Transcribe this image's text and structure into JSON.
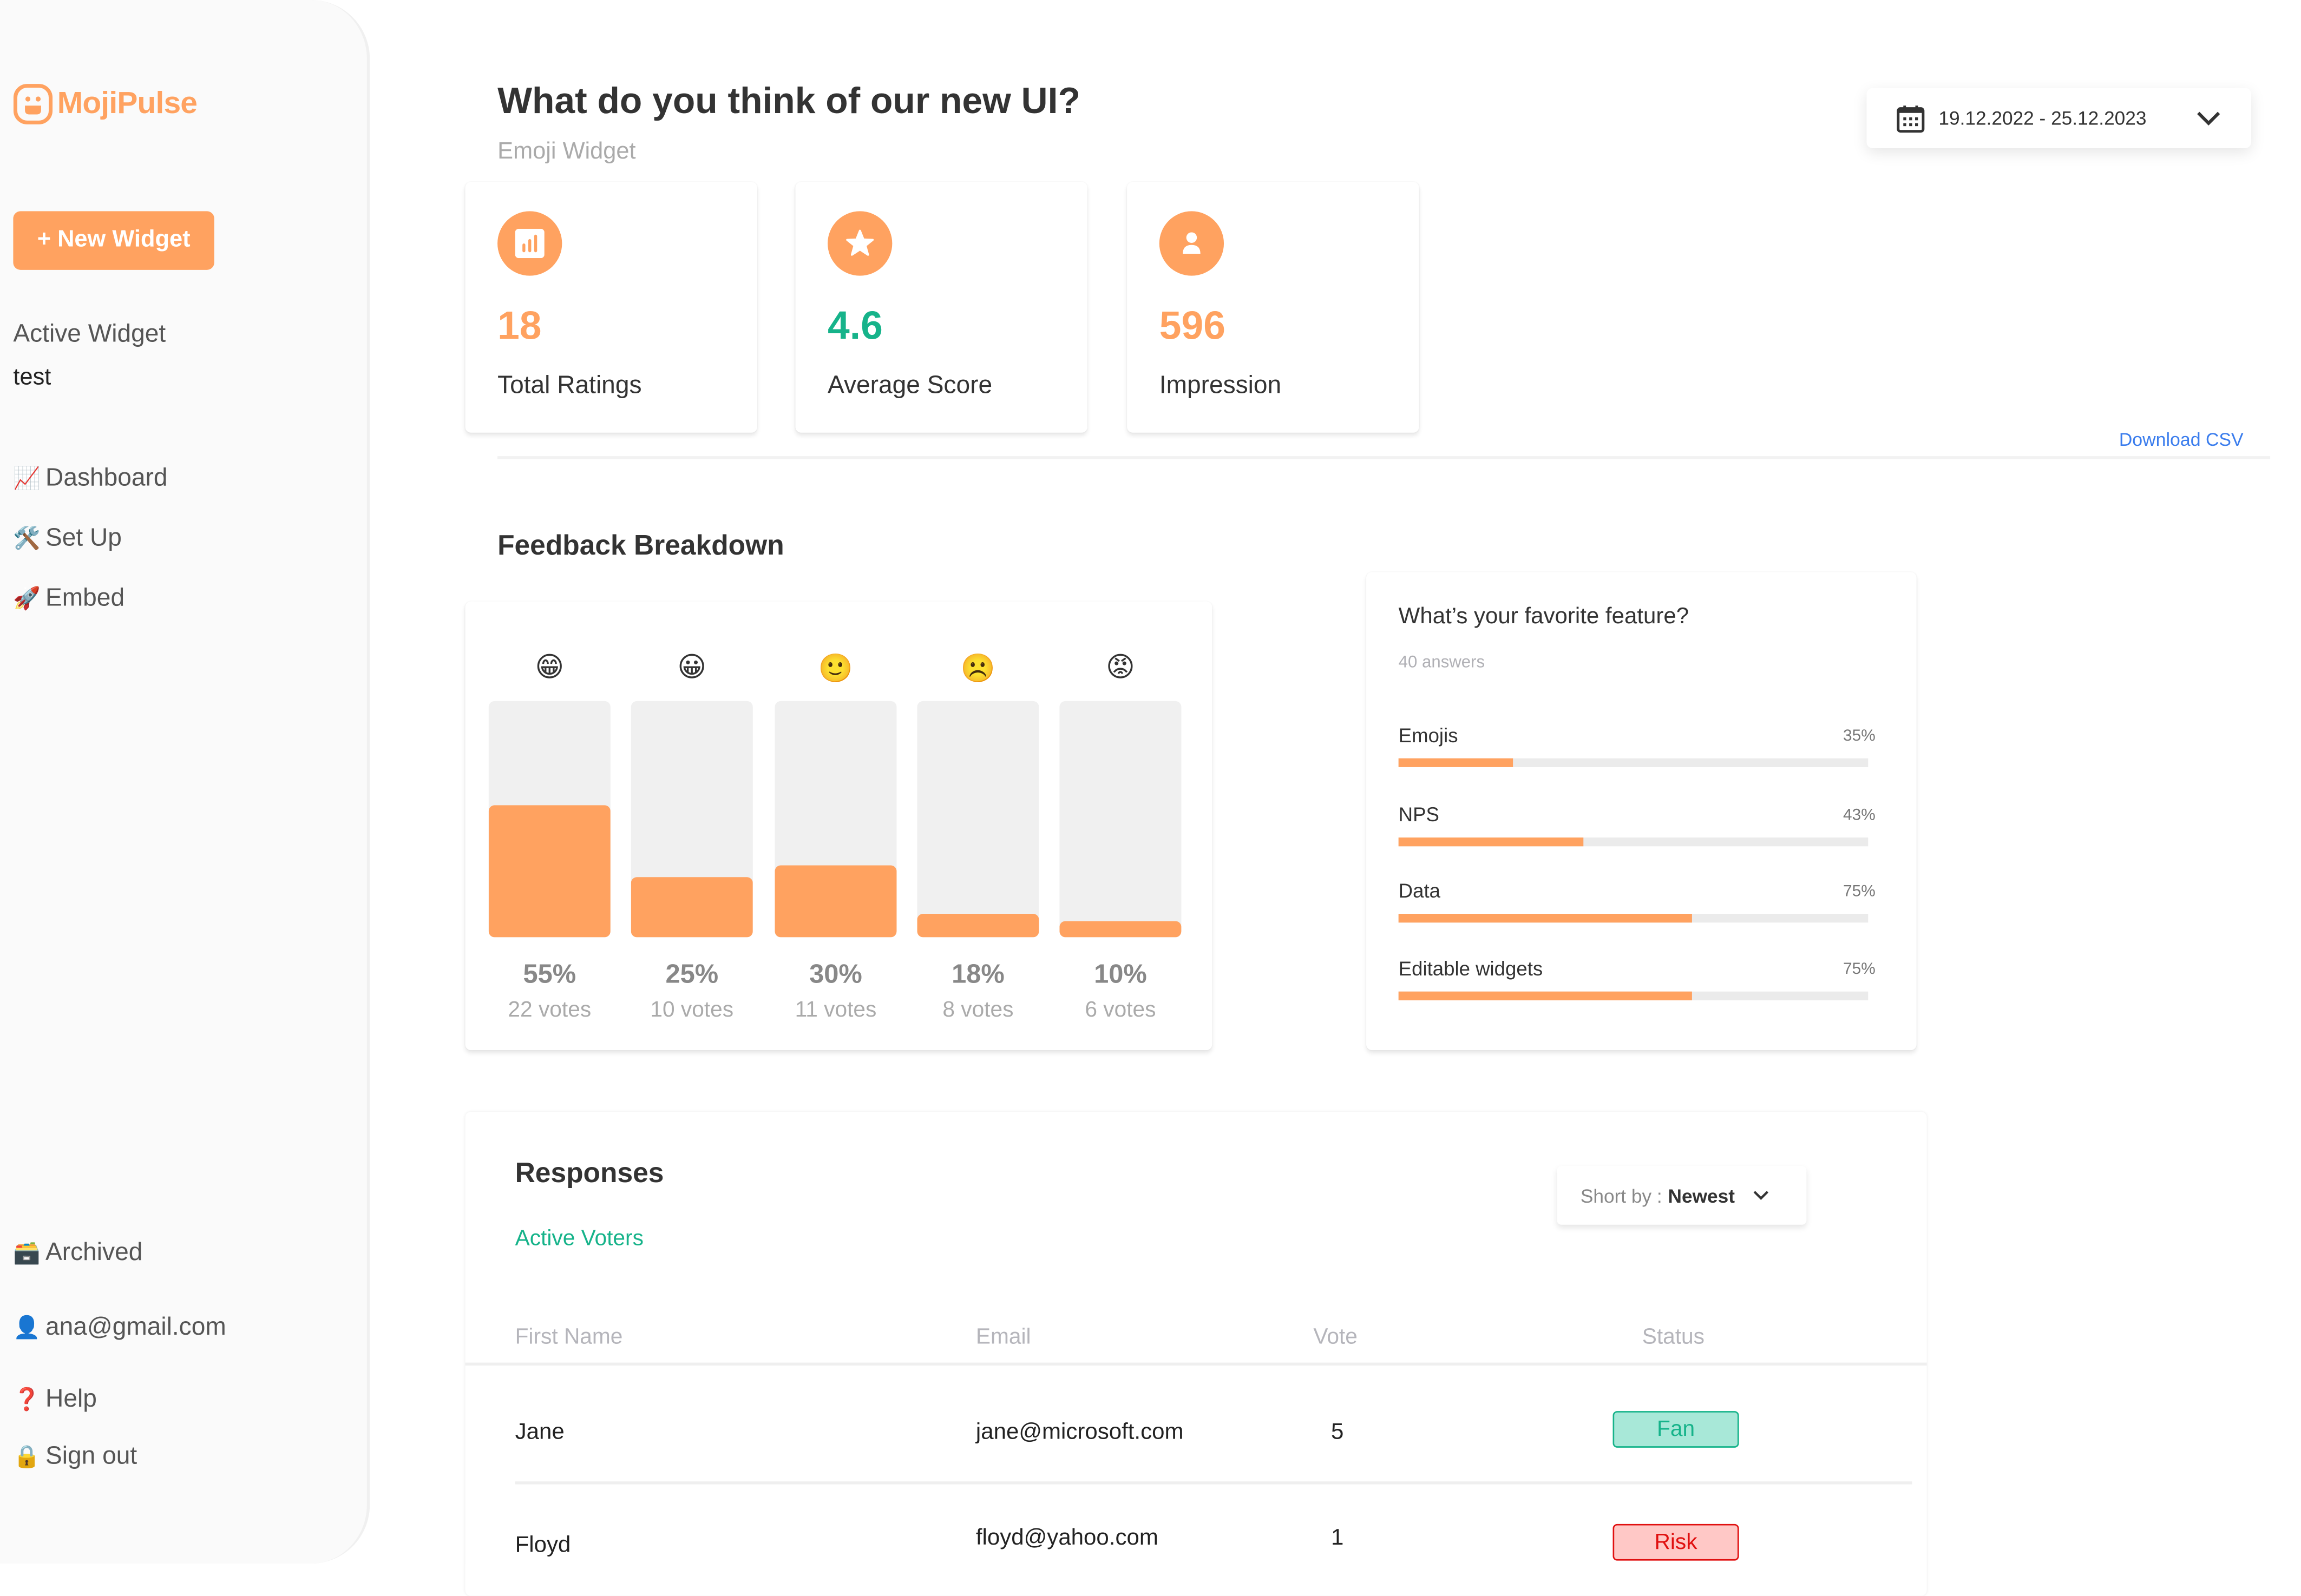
{
  "app": {
    "name": "MojiPulse",
    "brand_color": "#FFA260",
    "positive_color": "#16B38A",
    "link_color": "#3B7DED"
  },
  "sidebar": {
    "new_widget_label": "+ New Widget",
    "active_widget_label": "Active Widget",
    "active_widget_value": "test",
    "nav": [
      {
        "icon": "📈",
        "icon_name": "chart-increasing-icon",
        "label": "Dashboard"
      },
      {
        "icon": "🛠️",
        "icon_name": "hammer-wrench-icon",
        "label": "Set Up"
      },
      {
        "icon": "🚀",
        "icon_name": "rocket-icon",
        "label": "Embed"
      }
    ],
    "bottom": [
      {
        "icon": "🗃️",
        "icon_name": "card-file-box-icon",
        "label": "Archived"
      },
      {
        "icon": "👤",
        "icon_name": "user-icon",
        "label": "ana@gmail.com"
      },
      {
        "icon": "❓",
        "icon_name": "question-mark-icon",
        "label": "Help"
      },
      {
        "icon": "🔒",
        "icon_name": "lock-icon",
        "label": "Sign out"
      }
    ]
  },
  "header": {
    "title": "What do you think of our new UI?",
    "subtitle": "Emoji Widget",
    "date_range": "19.12.2022 - 25.12.2023"
  },
  "stats": [
    {
      "icon_name": "bar-chart-icon",
      "value": "18",
      "label": "Total Ratings",
      "color": "#FFA260"
    },
    {
      "icon_name": "star-icon",
      "value": "4.6",
      "label": "Average Score",
      "color": "#16B38A"
    },
    {
      "icon_name": "user-icon",
      "value": "596",
      "label": "Impression",
      "color": "#FFA260"
    }
  ],
  "download_csv_label": "Download CSV",
  "feedback": {
    "title": "Feedback Breakdown",
    "items": [
      {
        "emoji": "😁",
        "icon_name": "beaming-face-icon",
        "percent": 55,
        "percent_label": "55%",
        "votes_label": "22 votes"
      },
      {
        "emoji": "😀",
        "icon_name": "grinning-face-icon",
        "percent": 25,
        "percent_label": "25%",
        "votes_label": "10 votes"
      },
      {
        "emoji": "🙂",
        "icon_name": "slightly-smiling-face-icon",
        "percent": 30,
        "percent_label": "30%",
        "votes_label": "11 votes"
      },
      {
        "emoji": "☹️",
        "icon_name": "frowning-face-icon",
        "percent": 10,
        "percent_label": "18%",
        "votes_label": "8 votes"
      },
      {
        "emoji": "😡",
        "icon_name": "angry-face-icon",
        "percent": 7,
        "percent_label": "10%",
        "votes_label": "6 votes"
      }
    ]
  },
  "favorite_feature": {
    "title": "What’s your favorite feature?",
    "answers_label": "40 answers",
    "items": [
      {
        "label": "Emojis",
        "percent_label": "35%",
        "fill": 0.245
      },
      {
        "label": "NPS",
        "percent_label": "43%",
        "fill": 0.395
      },
      {
        "label": "Data",
        "percent_label": "75%",
        "fill": 0.625
      },
      {
        "label": "Editable widgets",
        "percent_label": "75%",
        "fill": 0.625
      }
    ]
  },
  "responses": {
    "title": "Responses",
    "tab_label": "Active Voters",
    "sort_prefix": "Short by :",
    "sort_value": "Newest",
    "columns": [
      "First Name",
      "Email",
      "Vote",
      "Status"
    ],
    "rows": [
      {
        "first_name": "Jane",
        "email": "jane@microsoft.com",
        "vote": "5",
        "status": "Fan",
        "status_type": "fan"
      },
      {
        "first_name": "Floyd",
        "email": "floyd@yahoo.com",
        "vote": "1",
        "status": "Risk",
        "status_type": "risk"
      }
    ]
  }
}
